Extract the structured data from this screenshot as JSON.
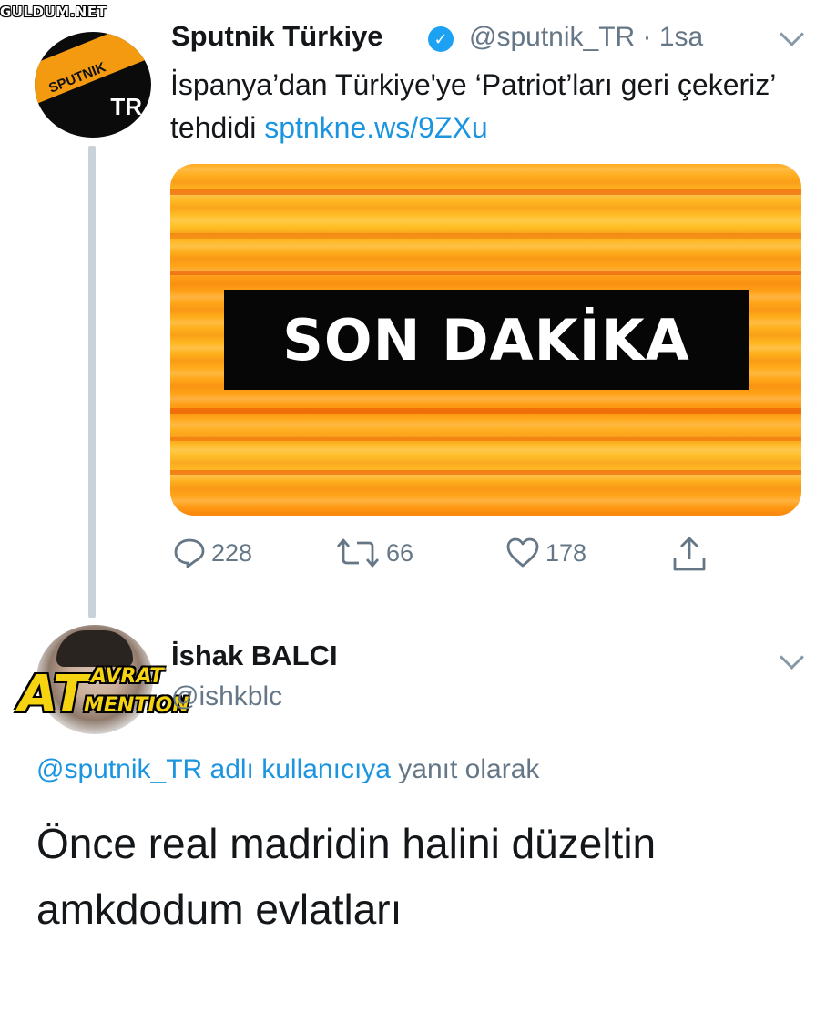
{
  "watermark": "GULDUM.NET",
  "tweet": {
    "avatar": {
      "brand": "SPUTNIK",
      "badge": "TR"
    },
    "author_name": "Sputnik Türkiye",
    "verified_icon": "verified-badge-icon",
    "handle_time": "@sputnik_TR · 1sa",
    "text": "İspanya’dan Türkiye'ye ‘Patriot’ları geri çekeriz’ tehdidi ",
    "link": "sptnkne.ws/9ZXu",
    "media_banner": "SON DAKİKA",
    "actions": {
      "reply_count": "228",
      "retweet_count": "66",
      "like_count": "178"
    }
  },
  "reply": {
    "avatar_logo": {
      "big": "AT",
      "line1": "AVRAT",
      "line2": "MENTION"
    },
    "author_name": "İshak BALCI",
    "handle": "@ishkblc",
    "reply_to_link": "@sputnik_TR adlı kullanıcıya",
    "reply_to_suffix": " yanıt olarak",
    "text": "Önce real madridin halini düzeltin amkdodum evlatları"
  },
  "colors": {
    "link": "#1b95e0",
    "muted": "#657786",
    "verified": "#1da1f2",
    "accent_orange": "#ffab1e"
  }
}
